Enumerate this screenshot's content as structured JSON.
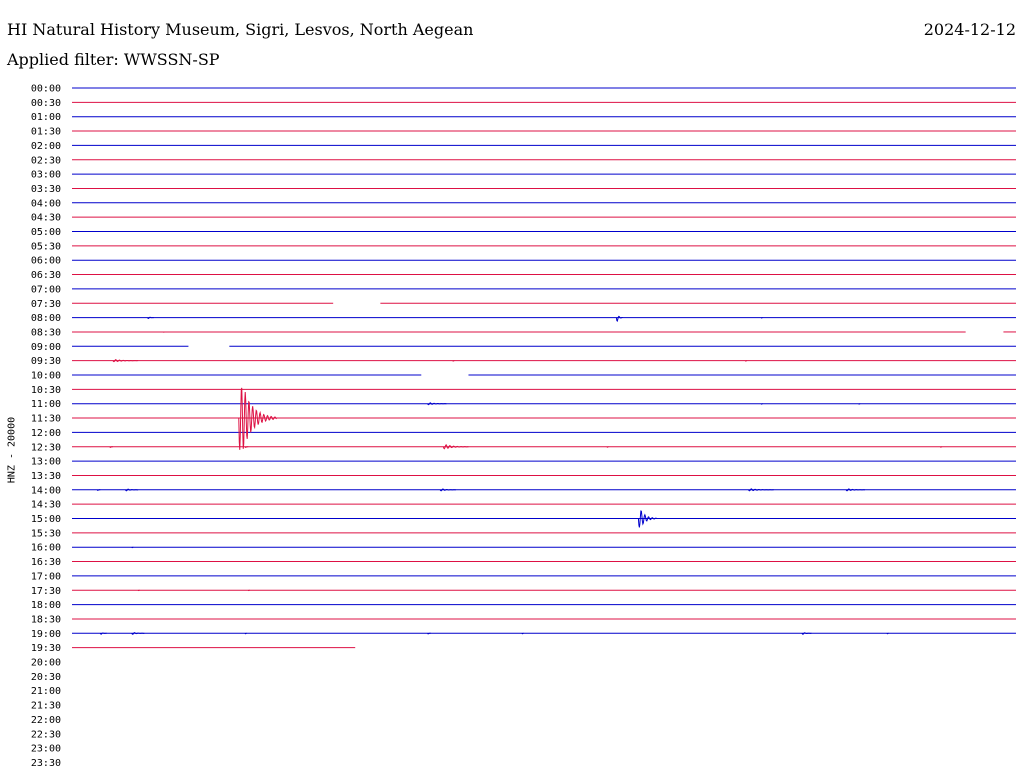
{
  "header": {
    "title": "HI Natural History Museum, Sigri, Lesvos, North Aegean",
    "date": "2024-12-12",
    "filter": "Applied filter: WWSSN-SP"
  },
  "colors": {
    "trace_a": "#0000cc",
    "trace_b": "#dd1144",
    "text": "#000000",
    "background": "#ffffff"
  },
  "chart_data": {
    "type": "line",
    "title": "HI Natural History Museum, Sigri, Lesvos, North Aegean",
    "ylabel": "HNZ - 20000",
    "x_unit": "minutes within each 30-minute row",
    "xlim": [
      0,
      30
    ],
    "row_labels": [
      "00:00",
      "00:30",
      "01:00",
      "01:30",
      "02:00",
      "02:30",
      "03:00",
      "03:30",
      "04:00",
      "04:30",
      "05:00",
      "05:30",
      "06:00",
      "06:30",
      "07:00",
      "07:30",
      "08:00",
      "08:30",
      "09:00",
      "09:30",
      "10:00",
      "10:30",
      "11:00",
      "11:30",
      "12:00",
      "12:30",
      "13:00",
      "13:30",
      "14:00",
      "14:30",
      "15:00",
      "15:30",
      "16:00",
      "16:30",
      "17:00",
      "17:30",
      "18:00",
      "18:30",
      "19:00",
      "19:30",
      "20:00",
      "20:30",
      "21:00",
      "21:30",
      "22:00",
      "22:30",
      "23:00",
      "23:30"
    ],
    "trace_colors": [
      "#0000cc",
      "#dd1144"
    ],
    "recorded_until_row": 39,
    "last_row_end_minute": 9.0,
    "gaps": [
      {
        "row": 15,
        "from_minute": 8.3,
        "to_minute": 9.8
      },
      {
        "row": 17,
        "from_minute": 28.4,
        "to_minute": 29.6
      },
      {
        "row": 18,
        "from_minute": 3.7,
        "to_minute": 5.0
      },
      {
        "row": 20,
        "from_minute": 11.1,
        "to_minute": 12.6
      }
    ],
    "events": [
      {
        "row": 16,
        "minute": 2.4,
        "amplitude": 1,
        "duration": 0.2
      },
      {
        "row": 16,
        "minute": 17.3,
        "amplitude": 4,
        "duration": 0.2
      },
      {
        "row": 16,
        "minute": 21.9,
        "amplitude": 1,
        "duration": 0.05
      },
      {
        "row": 17,
        "minute": 2.9,
        "amplitude": 0,
        "duration": 0.05
      },
      {
        "row": 19,
        "minute": 1.3,
        "amplitude": 1,
        "duration": 0.8
      },
      {
        "row": 19,
        "minute": 12.1,
        "amplitude": 1,
        "duration": 0.05
      },
      {
        "row": 19,
        "minute": 21.4,
        "amplitude": 1,
        "duration": 0.05
      },
      {
        "row": 22,
        "minute": 11.3,
        "amplitude": 1,
        "duration": 0.6
      },
      {
        "row": 22,
        "minute": 21.9,
        "amplitude": 1,
        "duration": 0.05
      },
      {
        "row": 22,
        "minute": 25.0,
        "amplitude": 1,
        "duration": 0.05
      },
      {
        "row": 23,
        "minute": 5.3,
        "amplitude": 32,
        "duration": 1.2
      },
      {
        "row": 25,
        "minute": 1.2,
        "amplitude": 1,
        "duration": 0.1
      },
      {
        "row": 25,
        "minute": 5.5,
        "amplitude": 1,
        "duration": 0.1
      },
      {
        "row": 25,
        "minute": 11.8,
        "amplitude": 2,
        "duration": 0.8
      },
      {
        "row": 25,
        "minute": 17.0,
        "amplitude": 1,
        "duration": 0.05
      },
      {
        "row": 25,
        "minute": 27.6,
        "amplitude": 1,
        "duration": 0.05
      },
      {
        "row": 28,
        "minute": 0.8,
        "amplitude": 1,
        "duration": 0.1
      },
      {
        "row": 28,
        "minute": 1.7,
        "amplitude": 1,
        "duration": 0.4
      },
      {
        "row": 28,
        "minute": 11.7,
        "amplitude": 1,
        "duration": 0.5
      },
      {
        "row": 28,
        "minute": 21.5,
        "amplitude": 1,
        "duration": 0.8
      },
      {
        "row": 28,
        "minute": 24.6,
        "amplitude": 1,
        "duration": 0.6
      },
      {
        "row": 30,
        "minute": 18.0,
        "amplitude": 9,
        "duration": 0.6
      },
      {
        "row": 32,
        "minute": 1.9,
        "amplitude": 1,
        "duration": 0.05
      },
      {
        "row": 35,
        "minute": 2.1,
        "amplitude": 0,
        "duration": 0.05
      },
      {
        "row": 35,
        "minute": 5.6,
        "amplitude": 0,
        "duration": 0.05
      },
      {
        "row": 38,
        "minute": 0.9,
        "amplitude": 1,
        "duration": 0.2
      },
      {
        "row": 38,
        "minute": 1.9,
        "amplitude": 1,
        "duration": 0.4
      },
      {
        "row": 38,
        "minute": 5.5,
        "amplitude": 1,
        "duration": 0.05
      },
      {
        "row": 38,
        "minute": 11.3,
        "amplitude": 1,
        "duration": 0.1
      },
      {
        "row": 38,
        "minute": 14.3,
        "amplitude": 1,
        "duration": 0.05
      },
      {
        "row": 38,
        "minute": 23.2,
        "amplitude": 1,
        "duration": 0.3
      },
      {
        "row": 38,
        "minute": 25.9,
        "amplitude": 1,
        "duration": 0.05
      }
    ]
  }
}
